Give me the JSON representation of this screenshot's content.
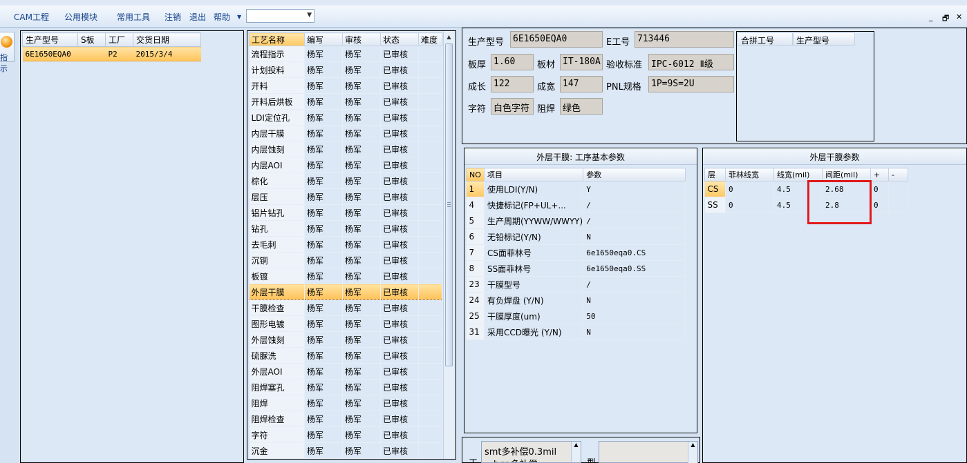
{
  "menu": {
    "items": [
      "CAM工程",
      "公用模块",
      "常用工具",
      "注销",
      "退出",
      "帮助"
    ],
    "dropdown_value": "",
    "window_controls": [
      "_",
      "🗗",
      "✕"
    ]
  },
  "side_button": {
    "label": "指示"
  },
  "orders": {
    "columns": [
      "生产型号",
      "S板",
      "工厂",
      "交货日期"
    ],
    "rows": [
      {
        "model": "6E1650EQA0",
        "s_board": "",
        "factory": "P2",
        "date": "2015/3/4"
      }
    ]
  },
  "processes": {
    "columns": [
      "工艺名称",
      "编写",
      "审核",
      "状态",
      "难度"
    ],
    "selected_index": 15,
    "rows": [
      [
        "流程指示",
        "杨军",
        "杨军",
        "已审核",
        ""
      ],
      [
        "计划投料",
        "杨军",
        "杨军",
        "已审核",
        ""
      ],
      [
        "开料",
        "杨军",
        "杨军",
        "已审核",
        ""
      ],
      [
        "开料后烘板",
        "杨军",
        "杨军",
        "已审核",
        ""
      ],
      [
        "LDI定位孔",
        "杨军",
        "杨军",
        "已审核",
        ""
      ],
      [
        "内层干膜",
        "杨军",
        "杨军",
        "已审核",
        ""
      ],
      [
        "内层蚀刻",
        "杨军",
        "杨军",
        "已审核",
        ""
      ],
      [
        "内层AOI",
        "杨军",
        "杨军",
        "已审核",
        ""
      ],
      [
        "棕化",
        "杨军",
        "杨军",
        "已审核",
        ""
      ],
      [
        "层压",
        "杨军",
        "杨军",
        "已审核",
        ""
      ],
      [
        "铝片钻孔",
        "杨军",
        "杨军",
        "已审核",
        ""
      ],
      [
        "钻孔",
        "杨军",
        "杨军",
        "已审核",
        ""
      ],
      [
        "去毛刺",
        "杨军",
        "杨军",
        "已审核",
        ""
      ],
      [
        "沉铜",
        "杨军",
        "杨军",
        "已审核",
        ""
      ],
      [
        "板镀",
        "杨军",
        "杨军",
        "已审核",
        ""
      ],
      [
        "外层干膜",
        "杨军",
        "杨军",
        "已审核",
        ""
      ],
      [
        "干膜检查",
        "杨军",
        "杨军",
        "已审核",
        ""
      ],
      [
        "图形电镀",
        "杨军",
        "杨军",
        "已审核",
        ""
      ],
      [
        "外层蚀刻",
        "杨军",
        "杨军",
        "已审核",
        ""
      ],
      [
        "硫脲洗",
        "杨军",
        "杨军",
        "已审核",
        ""
      ],
      [
        "外层AOI",
        "杨军",
        "杨军",
        "已审核",
        ""
      ],
      [
        "阻焊塞孔",
        "杨军",
        "杨军",
        "已审核",
        ""
      ],
      [
        "阻焊",
        "杨军",
        "杨军",
        "已审核",
        ""
      ],
      [
        "阻焊检查",
        "杨军",
        "杨军",
        "已审核",
        ""
      ],
      [
        "字符",
        "杨军",
        "杨军",
        "已审核",
        ""
      ],
      [
        "沉金",
        "杨军",
        "杨军",
        "已审核",
        ""
      ]
    ]
  },
  "info": {
    "model_label": "生产型号",
    "model_value": "6E1650EQA0",
    "ejob_label": "E工号",
    "ejob_value": "713446",
    "thickness_label": "板厚",
    "thickness_value": "1.60",
    "material_label": "板材",
    "material_value": "IT-180A",
    "standard_label": "验收标准",
    "standard_value": "IPC-6012 Ⅱ级",
    "length_label": "成长",
    "length_value": "122",
    "width_label": "成宽",
    "width_value": "147",
    "pnl_label": "PNL规格",
    "pnl_value": "1P=9S=2U",
    "char_label": "字符",
    "char_value": "白色字符",
    "mask_label": "阻焊",
    "mask_value": "绿色",
    "merge_columns": [
      "合拼工号",
      "生产型号"
    ]
  },
  "basic_params": {
    "title": "外层干膜: 工序基本参数",
    "columns": [
      "NO",
      "项目",
      "参数"
    ],
    "rows": [
      [
        "1",
        "使用LDI(Y/N)",
        "Y"
      ],
      [
        "4",
        "快捷标记(FP+UL+...",
        "/"
      ],
      [
        "5",
        "生产周期(YYWW/WWYY)",
        "/"
      ],
      [
        "6",
        "无铅标记(Y/N)",
        "N"
      ],
      [
        "7",
        "CS面菲林号",
        "6e1650eqa0.CS"
      ],
      [
        "8",
        "SS面菲林号",
        "6e1650eqa0.SS"
      ],
      [
        "23",
        "干膜型号",
        "/"
      ],
      [
        "24",
        "有负焊盘 (Y/N)",
        "N"
      ],
      [
        "25",
        "干膜厚度(um)",
        "50"
      ],
      [
        "31",
        "采用CCD曝光 (Y/N)",
        "N"
      ]
    ]
  },
  "film_params": {
    "title": "外层干膜参数",
    "columns": [
      "层",
      "菲林线宽",
      "线宽(mil)",
      "间距(mil)",
      "+",
      "-"
    ],
    "rows": [
      [
        "CS",
        "0",
        "4.5",
        "2.68",
        "0",
        ""
      ],
      [
        "SS",
        "0",
        "4.5",
        "2.8",
        "0",
        ""
      ]
    ]
  },
  "notes": {
    "side_label_1": "工",
    "side_label_2": "型",
    "line1": "smt多补偿0.3mil",
    "line2": "，bga多补偿"
  }
}
